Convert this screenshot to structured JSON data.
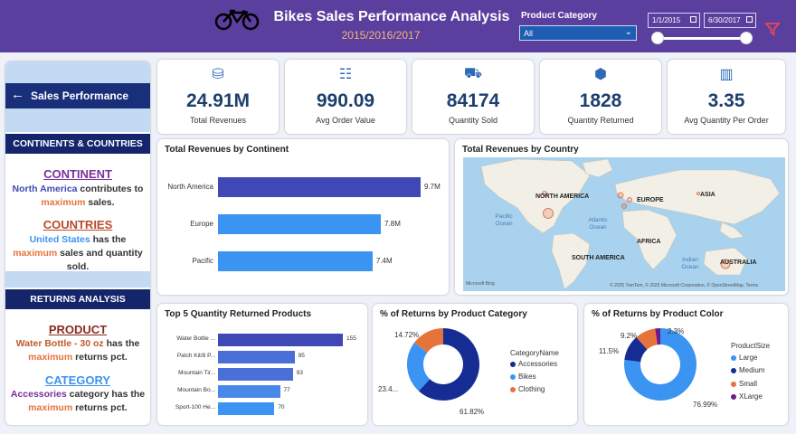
{
  "header": {
    "title": "Bikes Sales Performance Analysis",
    "subtitle": "2015/2016/2017",
    "product_category_label": "Product Category",
    "product_category_value": "All",
    "date_start": "1/1/2015",
    "date_end": "6/30/2017"
  },
  "sidebar": {
    "nav_label": "Sales Performance",
    "section1": "CONTINENTS & COUNTRIES",
    "continent_head": "CONTINENT",
    "continent_text_1": "North America",
    "continent_text_2": " contributes to ",
    "continent_text_3": "maximum",
    "continent_text_4": " sales.",
    "countries_head": "COUNTRIES",
    "countries_text_1": "United States",
    "countries_text_2": " has the ",
    "countries_text_3": "maximum",
    "countries_text_4": " sales and quantity sold.",
    "section2": "RETURNS ANALYSIS",
    "product_head": "PRODUCT",
    "product_text_1": "Water Bottle - 30 oz",
    "product_text_2": " has the ",
    "product_text_3": "maximum",
    "product_text_4": " returns pct.",
    "category_head": "CATEGORY",
    "category_text_1": "Accessories",
    "category_text_2": " category has the ",
    "category_text_3": "maximum",
    "category_text_4": " returns pct."
  },
  "kpis": [
    {
      "value": "24.91M",
      "label": "Total Revenues",
      "icon": "money-icon"
    },
    {
      "value": "990.09",
      "label": "Avg Order Value",
      "icon": "clipboard-icon"
    },
    {
      "value": "84174",
      "label": "Quantity Sold",
      "icon": "delivery-icon"
    },
    {
      "value": "1828",
      "label": "Quantity Returned",
      "icon": "box-icon"
    },
    {
      "value": "3.35",
      "label": "Avg Quantity Per Order",
      "icon": "bar-chart-icon"
    }
  ],
  "map": {
    "title": "Total Revenues by Country",
    "labels": [
      "NORTH AMERICA",
      "EUROPE",
      "ASIA",
      "AFRICA",
      "SOUTH AMERICA",
      "AUSTRALIA"
    ],
    "oceans": [
      "Pacific Ocean",
      "Atlantic Ocean",
      "Indian Ocean"
    ],
    "attribution": "© 2025 TomTom, © 2025 Microsoft Corporation, © OpenStreetMap, Terms",
    "logo": "Microsoft Bing"
  },
  "colors": {
    "header": "#5b3f9e",
    "navy": "#14256b",
    "bar_dark": "#3f48b4",
    "bar_light": "#3b94f1",
    "donut_dark": "#152c93",
    "donut_light": "#3b94f1",
    "donut_orange": "#e5733b",
    "donut_purple": "#6a1b8a"
  },
  "chart_data": [
    {
      "type": "bar",
      "title": "Total Revenues by Continent",
      "categories": [
        "North America",
        "Europe",
        "Pacific"
      ],
      "values": [
        9.7,
        7.8,
        7.4
      ],
      "value_labels": [
        "9.7M",
        "7.8M",
        "7.4M"
      ],
      "xlim": [
        0,
        9.7
      ]
    },
    {
      "type": "bar",
      "title": "Top 5 Quantity Returned Products",
      "categories": [
        "Water Bottle ...",
        "Patch Kit/8 P...",
        "Mountain Tir...",
        "Mountain Bo...",
        "Sport-100 He..."
      ],
      "values": [
        155,
        95,
        93,
        77,
        70
      ],
      "value_labels": [
        "155",
        "95",
        "93",
        "77",
        "70"
      ],
      "xlim": [
        0,
        155
      ]
    },
    {
      "type": "pie",
      "title": "% of Returns by Product Category",
      "legend_title": "CategoryName",
      "categories": [
        "Accessories",
        "Bikes",
        "Clothing"
      ],
      "values": [
        61.82,
        23.46,
        14.72
      ],
      "value_labels": [
        "61.82%",
        "23.4...",
        "14.72%"
      ]
    },
    {
      "type": "pie",
      "title": "% of Returns by Product Color",
      "legend_title": "ProductSize",
      "categories": [
        "Large",
        "Medium",
        "Small",
        "XLarge"
      ],
      "values": [
        76.99,
        11.5,
        9.2,
        2.3
      ],
      "value_labels": [
        "76.99%",
        "11.5%",
        "9.2%",
        "2.3%"
      ]
    }
  ]
}
